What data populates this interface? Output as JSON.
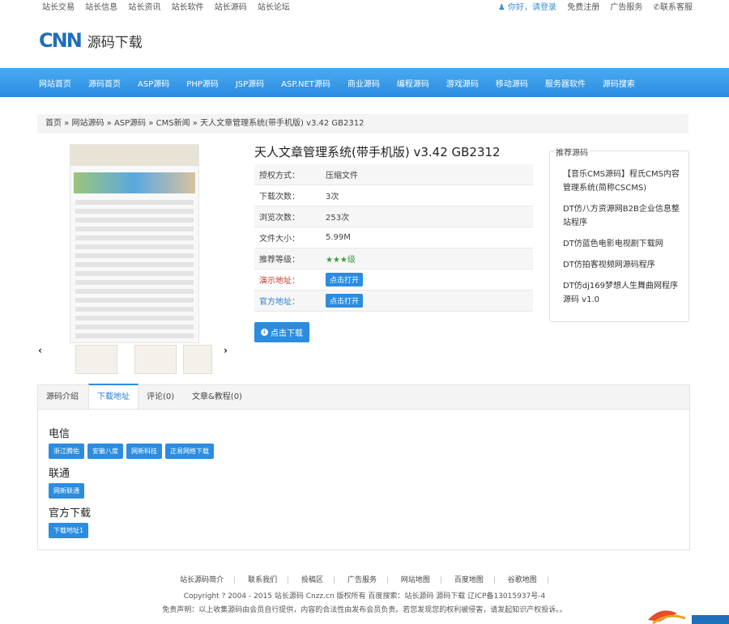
{
  "topbar": {
    "left_links": [
      "站长交易",
      "站长信息",
      "站长资讯",
      "站长软件",
      "站长源码",
      "站长论坛"
    ],
    "user_greeting": "你好，请登录",
    "register": "免费注册",
    "ads": "广告服务",
    "contact": "联系客服"
  },
  "logo": {
    "mark": "CNN",
    "text": "源码下载"
  },
  "nav": [
    "网站首页",
    "源码首页",
    "ASP源码",
    "PHP源码",
    "JSP源码",
    "ASP.NET源码",
    "商业源码",
    "编程源码",
    "游戏源码",
    "移动源码",
    "服务器软件",
    "源码搜索"
  ],
  "breadcrumb": "首页 » 网站源码 » ASP源码 » CMS新闻 » 天人文章管理系统(带手机版) v3.42 GB2312",
  "product": {
    "title": "天人文章管理系统(带手机版) v3.42 GB2312",
    "info": [
      {
        "key": "授权方式：",
        "value": "压缩文件"
      },
      {
        "key": "下载次数：",
        "value": "3次"
      },
      {
        "key": "浏览次数：",
        "value": "253次"
      },
      {
        "key": "文件大小：",
        "value": "5.99M"
      },
      {
        "key": "推荐等级：",
        "value": "★★★级"
      },
      {
        "key": "演示地址：",
        "button": "点击打开"
      },
      {
        "key": "官方地址：",
        "button": "点击打开"
      }
    ],
    "download_button": "点击下载"
  },
  "recommend": {
    "legend": "推荐源码",
    "items": [
      "【音乐CMS源码】程氏CMS内容管理系统(简称CSCMS)",
      "DT仿八方资源网B2B企业信息整站程序",
      "DT仿蓝色电影电视剧下载网",
      "DT仿拍客视频网源码程序",
      "DT仿dj169梦想人生舞曲网程序源码 v1.0"
    ]
  },
  "tabs": [
    "源码介绍",
    "下载地址",
    "评论(0)",
    "文章&教程(0)"
  ],
  "downloads": {
    "groups": [
      {
        "title": "电信",
        "mirrors": [
          "浙江腾佑",
          "安徽八度",
          "网新科技",
          "正易网络下载"
        ]
      },
      {
        "title": "联通",
        "mirrors": [
          "网新联通"
        ]
      },
      {
        "title": "官方下载",
        "mirrors": [
          "下载地址1"
        ]
      }
    ]
  },
  "footer": {
    "links": [
      "站长源码简介",
      "联系我们",
      "投稿区",
      "广告服务",
      "网站地图",
      "百度地图",
      "谷歌地图"
    ],
    "copyright": "Copyright ? 2004 - 2015 站长源码 Cnzz.cn 版权所有 百度搜索：站长源码 源码下载 辽ICP备13015937号-4",
    "disclaimer": "免责声明：以上收集源码由会员自行提供，内容的合法性由发布会员负责。若您发现您的权利被侵害，请发起知识产权投诉。。"
  },
  "colors": {
    "accent": "#2b8ce0",
    "nav_top": "#4aaaf0",
    "nav_bottom": "#2b8ce0"
  }
}
